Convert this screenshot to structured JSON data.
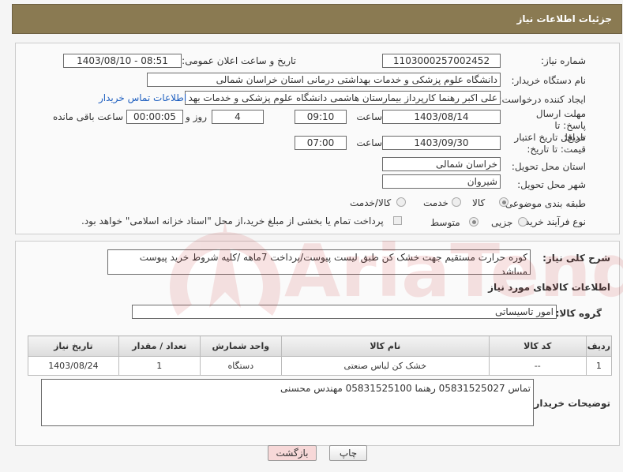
{
  "header": {
    "title": "جزئیات اطلاعات نیاز"
  },
  "fields": {
    "need_number_label": "شماره نیاز:",
    "need_number": "1103000257002452",
    "announce_label": "تاریخ و ساعت اعلان عمومی:",
    "announce_value": "1403/08/10 - 08:51",
    "buyer_org_label": "نام دستگاه خریدار:",
    "buyer_org": "دانشگاه علوم پزشکی و خدمات بهداشتی درمانی استان خراسان شمالی",
    "creator_label": "ایجاد کننده درخواست:",
    "creator": "علی اکبر رهنما کارپرداز بیمارستان هاشمی دانشگاه علوم پزشکی و خدمات بهد",
    "contact_link": "اطلاعات تماس خریدار",
    "reply_deadline_label": "مهلت ارسال پاسخ: تا تاریخ:",
    "reply_date": "1403/08/14",
    "time_label": "ساعت",
    "reply_time": "09:10",
    "days_value": "4",
    "days_label": "روز و",
    "remaining_time": "00:00:05",
    "remaining_label": "ساعت باقی مانده",
    "price_deadline_label": "حداقل تاریخ اعتبار قیمت: تا تاریخ:",
    "price_date": "1403/09/30",
    "price_time": "07:00",
    "province_label": "استان محل تحویل:",
    "province": "خراسان شمالی",
    "city_label": "شهر محل تحویل:",
    "city": "شیروان",
    "category_label": "طبقه بندی موضوعی:",
    "category_options": [
      "کالا",
      "خدمت",
      "کالا/خدمت"
    ],
    "purchase_type_label": "نوع فرآیند خرید :",
    "purchase_options": [
      "جزیی",
      "متوسط"
    ],
    "payment_note": "پرداخت تمام یا بخشی از مبلغ خرید،از محل \"اسناد خزانه اسلامی\" خواهد بود."
  },
  "description": {
    "label": "شرح کلی نیاز:",
    "text": "کوره حرارت مستقیم جهت خشک کن طبق لیست پیوست/پرداخت 7ماهه /کلیه شروط خرید پیوست میباشد"
  },
  "goods_section_title": "اطلاعات کالاهای مورد نیاز",
  "goods_group": {
    "label": "گروه کالا:",
    "value": "امور تاسیساتی"
  },
  "table": {
    "headers": [
      "ردیف",
      "کد کالا",
      "نام کالا",
      "واحد شمارش",
      "تعداد / مقدار",
      "تاریخ نیاز"
    ],
    "rows": [
      [
        "1",
        "--",
        "خشک کن لباس صنعتی",
        "دستگاه",
        "1",
        "1403/08/24"
      ]
    ]
  },
  "buyer_notes": {
    "label": "توضیحات خریدار:",
    "text": "تماس 05831525027 رهنما 05831525100 مهندس محسنی"
  },
  "buttons": {
    "print": "چاپ",
    "back": "بازگشت"
  },
  "watermark_text": "AriaTender.neT",
  "colors": {
    "header_bg": "#8a7a52",
    "link": "#2060c0",
    "back_button_bg": "#f7d8d8"
  }
}
